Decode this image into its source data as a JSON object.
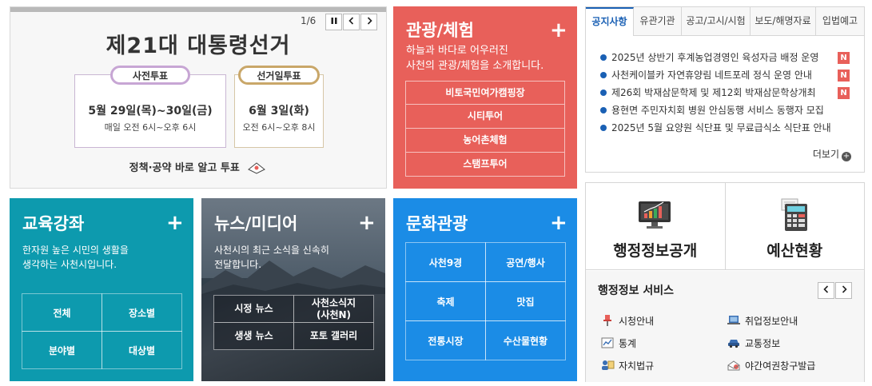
{
  "banner": {
    "title": "제21대 대통령선거",
    "pager": "1/6",
    "pre_vote": {
      "label": "사전투표",
      "date": "5월 29일(목)~30일(금)",
      "time": "매일 오전 6시~오후 6시"
    },
    "election_day": {
      "label": "선거일투표",
      "date": "6월 3일(화)",
      "time": "오전 6시~오후 8시"
    },
    "footer": "정책·공약 바로 알고 투표",
    "pause_icon": "pause-icon",
    "prev_icon": "chevron-left-icon",
    "next_icon": "chevron-right-icon"
  },
  "tour": {
    "title": "관광/체험",
    "desc_line1": "하늘과 바다로 어우러진",
    "desc_line2": "사천의 관광/체험을 소개합니다.",
    "items": [
      "비토국민여가캠핑장",
      "시티투어",
      "농어촌체험",
      "스탬프투어"
    ],
    "color": "#e8605a"
  },
  "notice": {
    "tabs": [
      "공지사항",
      "유관기관",
      "공고/고시/시험",
      "보도/해명자료",
      "입법예고"
    ],
    "items": [
      {
        "text": "2025년 상반기 후계농업경영인 육성자금 배정 운영",
        "badge": "N"
      },
      {
        "text": "사천케이블카 자연휴양림 네트포레 정식 운영 안내",
        "badge": "N"
      },
      {
        "text": "제26회 박재삼문학제 및 제12회 박재삼문학상개최",
        "badge": "N"
      },
      {
        "text": "용현면 주민자치회 병원 안심동행 서비스 동행자 모집",
        "badge": ""
      },
      {
        "text": "2025년 5월 요양원 식단표 및 무료급식소 식단표 안내",
        "badge": ""
      }
    ],
    "more": "더보기",
    "accent": "#1a60b4"
  },
  "edu": {
    "title": "교육강좌",
    "desc_line1": "한자원 높은 시민의 생활을",
    "desc_line2": "생각하는 사천시입니다.",
    "items": [
      "전체",
      "장소별",
      "분야별",
      "대상별"
    ],
    "color": "#0d9aae"
  },
  "news": {
    "title": "뉴스/미디어",
    "desc_line1": "사천시의 최근 소식을 신속히",
    "desc_line2": "전달합니다.",
    "items": [
      "시정 뉴스",
      "사천소식지\n(사천N)",
      "생생 뉴스",
      "포토 갤러리"
    ]
  },
  "culture": {
    "title": "문화관광",
    "items": [
      "사천9경",
      "공연/행사",
      "축제",
      "맛집",
      "전통시장",
      "수산물현황"
    ],
    "color": "#1b8ce6"
  },
  "admin": {
    "open_info": "행정정보공개",
    "budget": "예산현황",
    "service_title": "행정정보 서비스",
    "services": [
      {
        "label": "시청안내",
        "icon": "pin-icon"
      },
      {
        "label": "취업정보안내",
        "icon": "laptop-icon"
      },
      {
        "label": "통계",
        "icon": "chart-icon"
      },
      {
        "label": "교통정보",
        "icon": "car-icon"
      },
      {
        "label": "자치법규",
        "icon": "law-icon"
      },
      {
        "label": "야간여권창구발급",
        "icon": "passport-icon"
      }
    ]
  }
}
